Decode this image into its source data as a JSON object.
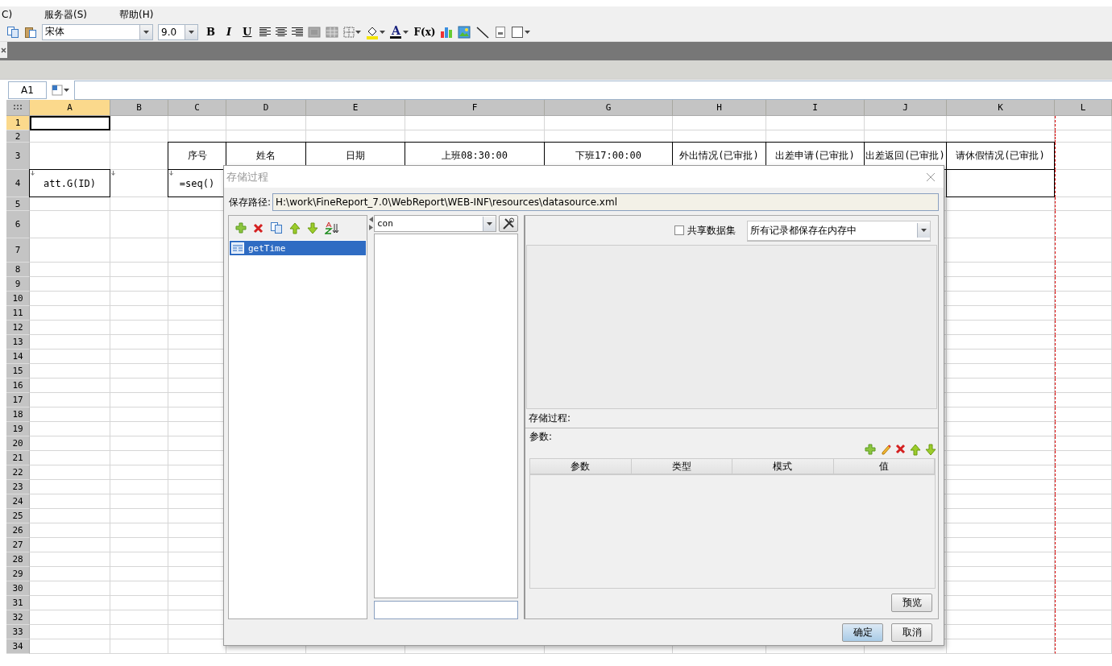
{
  "menu": [
    {
      "label": "C)"
    },
    {
      "label": "服务器(S)"
    },
    {
      "label": "帮助(H)"
    }
  ],
  "toolbar": {
    "font": "宋体",
    "size": "9.0",
    "styles": [
      "B",
      "I",
      "U"
    ],
    "font_color_letter": "A",
    "formula_label": "F(x)"
  },
  "formula_bar": {
    "cell": "A1"
  },
  "sheet": {
    "columns": [
      {
        "label": "A",
        "selected": true
      },
      {
        "label": "B",
        "selected": false
      },
      {
        "label": "C",
        "selected": false
      },
      {
        "label": "D",
        "selected": false
      },
      {
        "label": "E",
        "selected": false
      },
      {
        "label": "F",
        "selected": false
      },
      {
        "label": "G",
        "selected": false
      },
      {
        "label": "H",
        "selected": false
      },
      {
        "label": "I",
        "selected": false
      },
      {
        "label": "J",
        "selected": false
      },
      {
        "label": "K",
        "selected": false
      },
      {
        "label": "L",
        "selected": false
      }
    ],
    "rows": [
      {
        "label": "1",
        "selected": true,
        "cells": [
          {
            "selected": true,
            "bordered": false
          },
          {
            "selected": false,
            "bordered": false
          },
          {
            "selected": false,
            "bordered": false
          },
          {
            "selected": false,
            "bordered": false
          },
          {
            "selected": false,
            "bordered": false
          },
          {
            "selected": false,
            "bordered": false
          },
          {
            "selected": false,
            "bordered": false
          },
          {
            "selected": false,
            "bordered": false
          },
          {
            "selected": false,
            "bordered": false
          },
          {
            "selected": false,
            "bordered": false
          },
          {
            "selected": false,
            "bordered": false
          },
          {
            "selected": false,
            "bordered": false
          }
        ]
      },
      {
        "label": "2",
        "selected": false
      },
      {
        "label": "3",
        "selected": false,
        "cells": [
          {
            "selected": false,
            "bordered": false
          },
          {
            "selected": false,
            "bordered": false
          },
          {
            "selected": false,
            "bordered": true,
            "text": "序号"
          },
          {
            "selected": false,
            "bordered": true,
            "text": "姓名"
          },
          {
            "selected": false,
            "bordered": true,
            "text": "日期"
          },
          {
            "selected": false,
            "bordered": true,
            "text": "上班08:30:00"
          },
          {
            "selected": false,
            "bordered": true,
            "text": "下班17:00:00"
          },
          {
            "selected": false,
            "bordered": true,
            "text": "外出情况(已审批)"
          },
          {
            "selected": false,
            "bordered": true,
            "text": "出差申请(已审批)"
          },
          {
            "selected": false,
            "bordered": true,
            "text": "出差返回(已审批)"
          },
          {
            "selected": false,
            "bordered": true,
            "text": "请休假情况(已审批)"
          },
          {
            "selected": false,
            "bordered": false
          }
        ]
      },
      {
        "label": "4",
        "selected": false,
        "cells": [
          {
            "selected": false,
            "bordered": true,
            "expands": true,
            "text": "att.G(ID)"
          },
          {
            "selected": false,
            "bordered": false,
            "expands": true
          },
          {
            "selected": false,
            "bordered": true,
            "expands": true,
            "text": "=seq()"
          },
          null,
          null,
          null,
          null,
          null,
          null,
          null,
          {
            "selected": false,
            "bordered": true
          },
          {
            "selected": false,
            "bordered": false
          }
        ]
      },
      {
        "label": "5",
        "selected": false
      },
      {
        "label": "6",
        "selected": false
      },
      {
        "label": "7",
        "selected": false
      },
      {
        "label": "8",
        "selected": false
      },
      {
        "label": "9",
        "selected": false
      },
      {
        "label": "10",
        "selected": false
      },
      {
        "label": "11",
        "selected": false
      },
      {
        "label": "12",
        "selected": false
      },
      {
        "label": "13",
        "selected": false
      },
      {
        "label": "14",
        "selected": false
      },
      {
        "label": "15",
        "selected": false
      },
      {
        "label": "16",
        "selected": false
      },
      {
        "label": "17",
        "selected": false
      },
      {
        "label": "18",
        "selected": false
      },
      {
        "label": "19",
        "selected": false
      },
      {
        "label": "20",
        "selected": false
      },
      {
        "label": "21",
        "selected": false
      },
      {
        "label": "22",
        "selected": false
      },
      {
        "label": "23",
        "selected": false
      },
      {
        "label": "24",
        "selected": false
      },
      {
        "label": "25",
        "selected": false
      },
      {
        "label": "26",
        "selected": false
      },
      {
        "label": "27",
        "selected": false
      },
      {
        "label": "28",
        "selected": false
      },
      {
        "label": "29",
        "selected": false
      },
      {
        "label": "30",
        "selected": false
      },
      {
        "label": "31",
        "selected": false
      },
      {
        "label": "32",
        "selected": false
      },
      {
        "label": "33",
        "selected": false
      },
      {
        "label": "34",
        "selected": false
      }
    ]
  },
  "dialog": {
    "title": "存储过程",
    "path_label": "保存路径:",
    "path": "H:\\work\\FineReport_7.0\\WebReport\\WEB-INF\\resources\\datasource.xml",
    "procedures": [
      {
        "name": "getTime",
        "selected": true
      }
    ],
    "connection": "con",
    "share": {
      "label": "共享数据集",
      "checked": false
    },
    "storage_mode": "所有记录都保存在内存中",
    "procedure_label": "存储过程:",
    "params_label": "参数:",
    "param_columns": [
      "参数",
      "类型",
      "模式",
      "值"
    ],
    "preview": "预览",
    "buttons": [
      {
        "label": "确定",
        "default": true
      },
      {
        "label": "取消",
        "default": false
      }
    ]
  }
}
